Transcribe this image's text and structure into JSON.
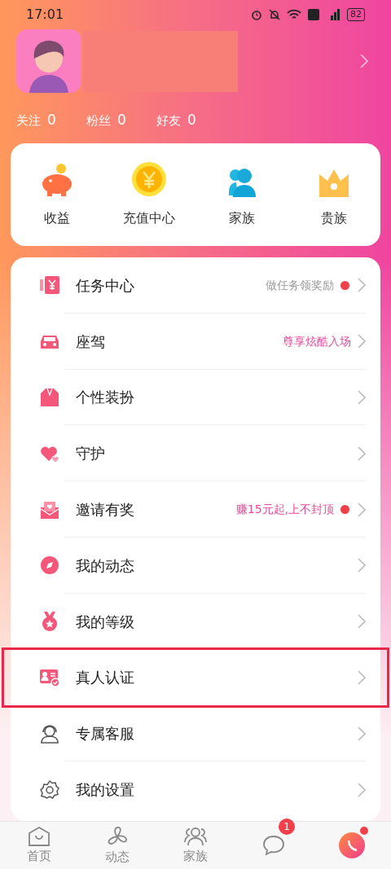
{
  "status_bar": {
    "time": "17:01",
    "battery": "82"
  },
  "profile": {
    "stats": [
      {
        "label": "关注",
        "value": "0"
      },
      {
        "label": "粉丝",
        "value": "0"
      },
      {
        "label": "好友",
        "value": "0"
      }
    ]
  },
  "shortcuts": [
    {
      "kind": "piggy",
      "label": "收益"
    },
    {
      "kind": "coin",
      "label": "充值中心"
    },
    {
      "kind": "family",
      "label": "家族"
    },
    {
      "kind": "crown",
      "label": "贵族"
    }
  ],
  "menu": [
    {
      "kind": "task",
      "label": "任务中心",
      "note": "做任务领奖励",
      "accent": false,
      "dot": true,
      "highlighted": false
    },
    {
      "kind": "car",
      "label": "座驾",
      "note": "尊享炫酷入场",
      "accent": true,
      "dot": false,
      "highlighted": false
    },
    {
      "kind": "suit",
      "label": "个性装扮",
      "dot": false,
      "highlighted": false
    },
    {
      "kind": "heart",
      "label": "守护",
      "dot": false,
      "highlighted": false
    },
    {
      "kind": "mail",
      "label": "邀请有奖",
      "note": "赚15元起,上不封顶",
      "accent": true,
      "dot": true,
      "highlighted": false
    },
    {
      "kind": "compass",
      "label": "我的动态",
      "dot": false,
      "highlighted": false
    },
    {
      "kind": "medal",
      "label": "我的等级",
      "dot": false,
      "highlighted": false
    },
    {
      "kind": "idcard",
      "label": "真人认证",
      "dot": false,
      "highlighted": true
    },
    {
      "kind": "agent",
      "label": "专属客服",
      "dot": false,
      "highlighted": false
    },
    {
      "kind": "gear",
      "label": "我的设置",
      "dot": false,
      "highlighted": false
    }
  ],
  "tab_bar": [
    {
      "kind": "home",
      "label": "首页",
      "selected": false
    },
    {
      "kind": "fan",
      "label": "动态",
      "selected": false
    },
    {
      "kind": "people",
      "label": "家族",
      "selected": false
    },
    {
      "kind": "chat",
      "badge": "1",
      "selected": false
    },
    {
      "kind": "call",
      "dot": true,
      "selected": false
    }
  ]
}
